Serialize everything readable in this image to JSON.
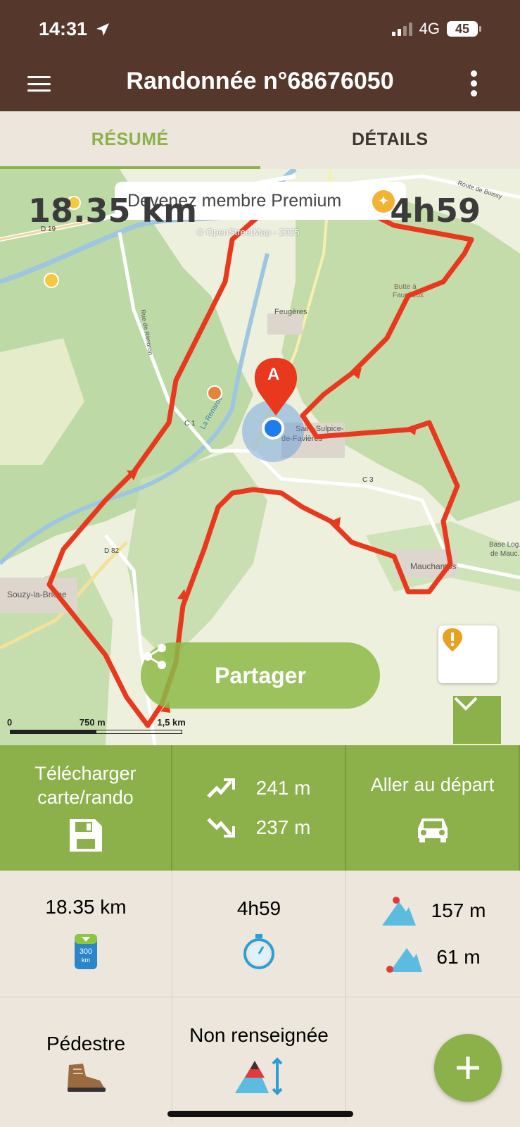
{
  "status": {
    "time": "14:31",
    "network": "4G",
    "battery": "45"
  },
  "header": {
    "title": "Randonnée n°68676050"
  },
  "tabs": [
    {
      "label": "RÉSUMÉ"
    },
    {
      "label": "DÉTAILS"
    }
  ],
  "map": {
    "distance": "18.35 km",
    "duration": "4h59",
    "premium_text": "Devenez membre Premium",
    "attribution": "© OpenStreetMap - 2025",
    "start_marker": "A",
    "share_label": "Partager",
    "scale_labels": [
      "0",
      "750 m",
      "1,5 km"
    ],
    "place_labels": [
      "Feugères",
      "Souzy-la-Briche",
      "Mauchamps",
      "Saint-Sulpice-de-Favières",
      "Butte à Faucheux",
      "D 19",
      "D 82",
      "C 1",
      "C 3",
      "Route de Boissy",
      "Rue de Rimoron",
      "La Renarde",
      "Base Log. de Mauc."
    ]
  },
  "actions": {
    "download_label": "Télécharger carte/rando",
    "ascent": "241 m",
    "descent": "237 m",
    "goto_label": "Aller au départ"
  },
  "stats": {
    "distance": "18.35 km",
    "duration": "4h59",
    "alt_max": "157 m",
    "alt_min": "61 m",
    "activity": "Pédestre",
    "difficulty": "Non renseignée"
  },
  "colors": {
    "brand": "#56372b",
    "accent": "#8cb04a",
    "track": "#e8391f"
  }
}
